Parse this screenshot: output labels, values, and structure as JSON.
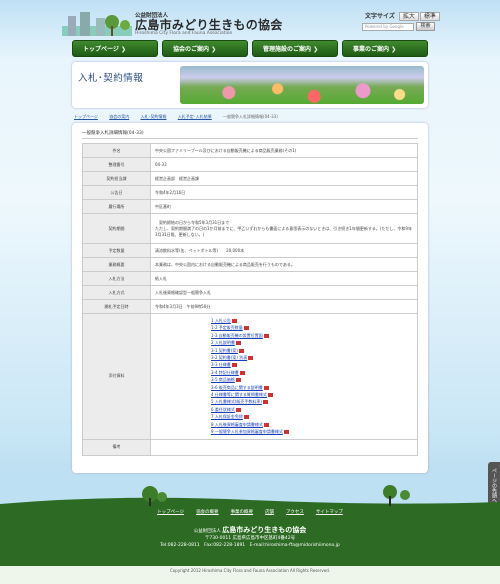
{
  "header": {
    "org_prefix": "公益財団法人",
    "org_name": "広島市みどり生きもの協会",
    "org_name_en": "Hiroshima City Flora and Fauna Association",
    "font_size_label": "文字サイズ",
    "font_large": "拡大",
    "font_standard": "標準",
    "search_placeholder": "Powered by Google",
    "search_button": "検索"
  },
  "nav": [
    "トップページ ❯",
    "協会のご案内 ❯",
    "管理施設のご案内 ❯",
    "事業のご案内 ❯"
  ],
  "banner": {
    "title": "入札･契約情報"
  },
  "breadcrumb": [
    "トップページ",
    "協会の案内",
    "入札･契約情報",
    "入札予定･入札結果",
    "一般競争入札詳細情報(04-33)"
  ],
  "page_title": "一般競争入札詳細情報(04-33)",
  "rows": [
    {
      "label": "件名",
      "value": "中央公園ファミリープール及びにおける自動販売機による商品販売業務(その1)"
    },
    {
      "label": "整理番号",
      "value": "04-33"
    },
    {
      "label": "契約担当課",
      "value": "経営企画部　経営企画課"
    },
    {
      "label": "公告日",
      "value": "令和4年2月16日"
    },
    {
      "label": "履行場所",
      "value": "中区基町"
    },
    {
      "label": "契約期間",
      "value": "　契約締結の日から令和5年3月31日まで\nただし、契約期間満了の日の1か月前までに、甲乙いずれからも書面による意思表示のないときは、引き続き1年間更新する。(ただし、令和9年3月31日限、更新しない。)"
    },
    {
      "label": "予定数量",
      "value": "清涼飲料水等(缶、ペットボトル等)　　20,000本"
    },
    {
      "label": "業務概要",
      "value": "本業務は、中央公園内における自動販売機による商品販売を行うものである。"
    },
    {
      "label": "入札方法",
      "value": "紙入札"
    },
    {
      "label": "入札方式",
      "value": "入札後資格確認型一般競争入札"
    },
    {
      "label": "開札予定日時",
      "value": "令和4年3月3日　午前9時50分"
    }
  ],
  "docs_label": "添付資料",
  "docs": [
    "1 入札公告",
    "1-2 予定販売数量",
    "1-3 自動販売機の設置位置図",
    "2 入札説明書",
    "3-1 契約書(案)",
    "3-2 契約書(案) 別表",
    "3-3 仕様書",
    "3-4 特記仕様書",
    "3-5 商品価格",
    "3-6 販売商品に関する説明書",
    "4 仕様書等に関する質問書様式",
    "5 入札書様式(販売手数料率)",
    "6 委任状様式",
    "7 入札保証金免除",
    "8 入札後資格審査申請書様式",
    "9 一般競争入札参加資格審査申請書様式"
  ],
  "remarks_label": "備考",
  "remarks_value": "",
  "pagetop": "ページの先頭へ",
  "footer": {
    "links": [
      "トップページ",
      "協会の概要",
      "事業の概要",
      "店舗",
      "アクセス",
      "サイトマップ"
    ],
    "org_prefix": "公益財団法人",
    "org_name": "広島市みどり生きもの協会",
    "address": "〒730-0011 広島県広島市中区基町4番42号",
    "contact": "Tel:082-228-0811　Fax:082-228-1891　E-mail:hiroshima-ffa@midorishiimono.jp",
    "copyright": "Copyright 2012 Hiroshima City Flora and Fauna Association All Rights Reserved."
  }
}
